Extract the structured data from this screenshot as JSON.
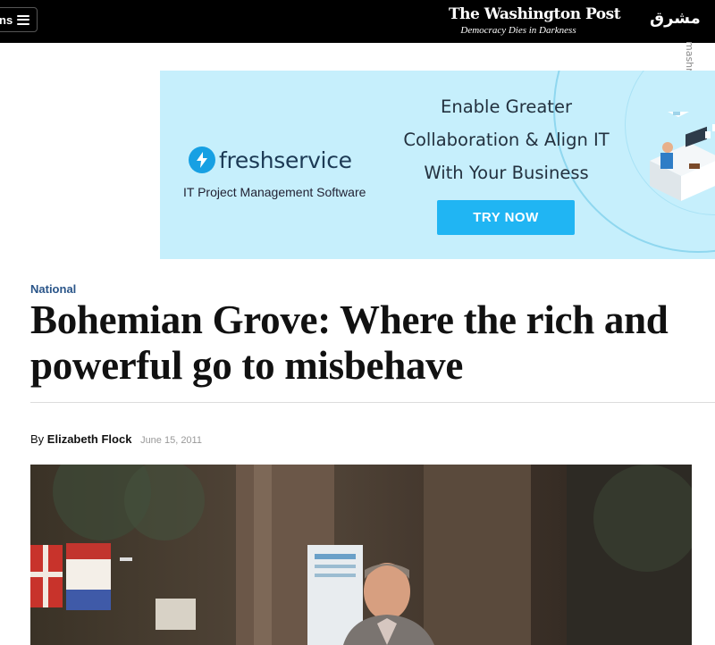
{
  "header": {
    "sections_label": "ns",
    "logo_name": "The Washington Post",
    "logo_tagline": "Democracy Dies in Darkness",
    "partner_logo_text": "مشرق"
  },
  "watermark": "mashreghnews.ir",
  "ad": {
    "brand": "freshservice",
    "subtitle": "IT Project Management Software",
    "headline_line1": "Enable Greater",
    "headline_line2": "Collaboration & Align IT",
    "headline_line3": "With Your Business",
    "cta": "TRY NOW",
    "bg_color": "#c6effc",
    "cta_color": "#20b5f3"
  },
  "article": {
    "kicker": "National",
    "headline": "Bohemian Grove: Where the rich and powerful go to misbehave",
    "byline_prefix": "By",
    "author": "Elizabeth Flock",
    "date": "June 15, 2011"
  },
  "icons": {
    "menu": "hamburger-icon",
    "brand": "lightning-bolt-icon"
  }
}
